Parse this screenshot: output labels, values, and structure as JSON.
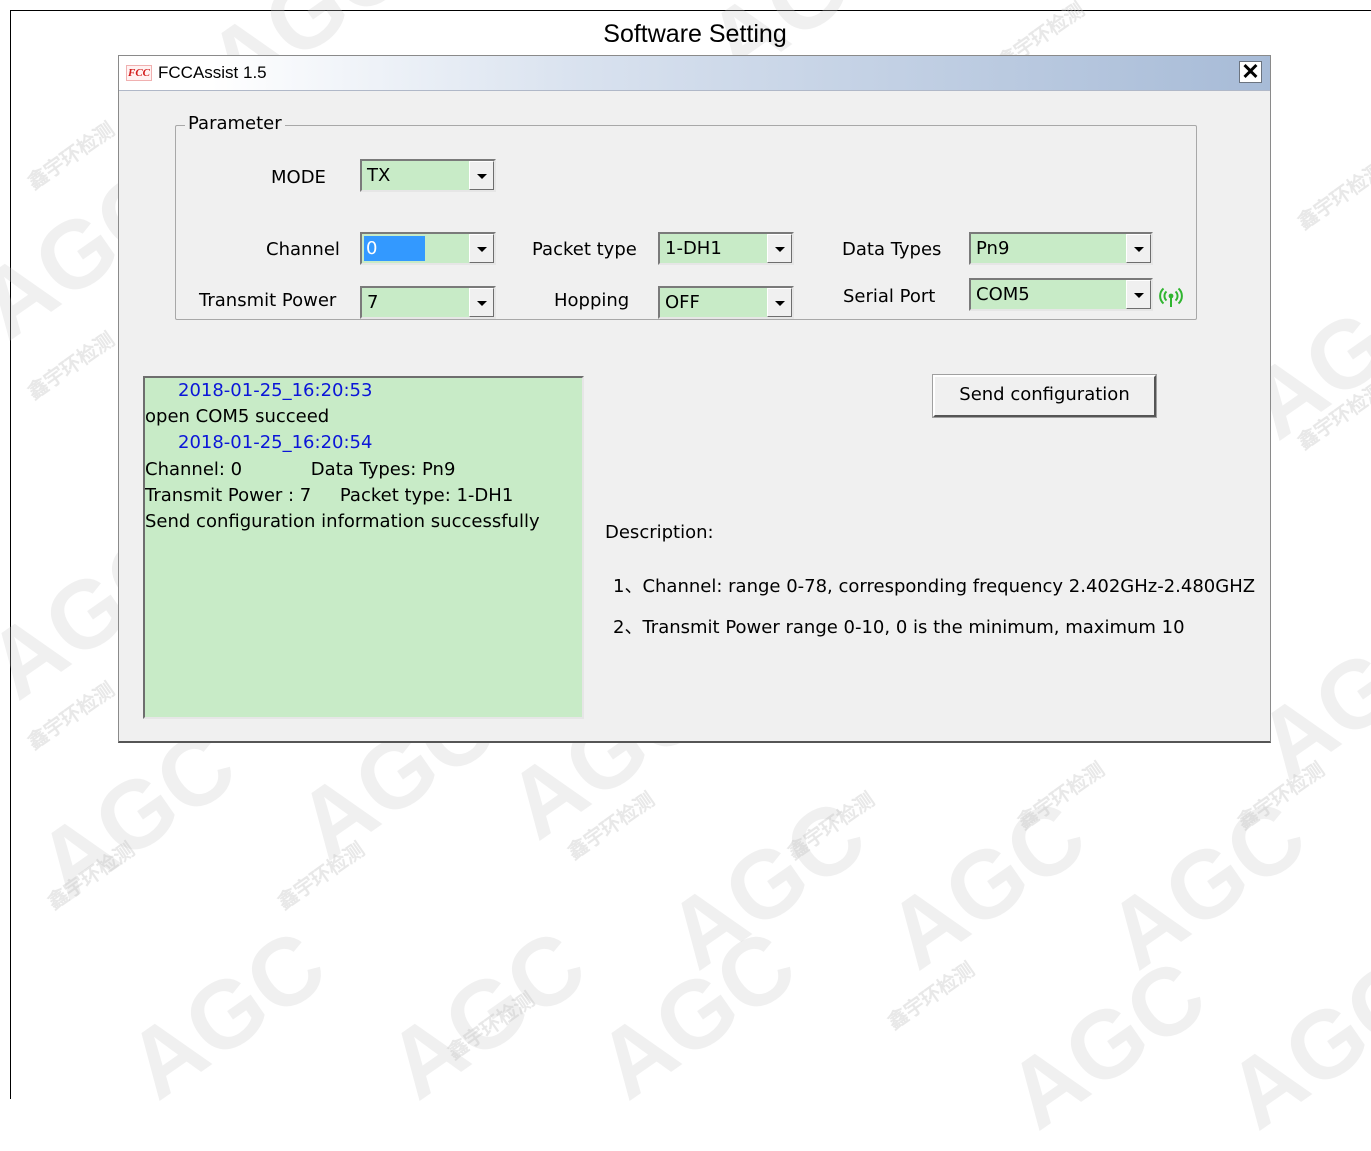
{
  "page": {
    "title": "Software Setting"
  },
  "window": {
    "icon_label": "FCC",
    "title": "FCCAssist 1.5",
    "close_label": "✕"
  },
  "parameter": {
    "group_label": "Parameter",
    "mode": {
      "label": "MODE",
      "value": "TX"
    },
    "channel": {
      "label": "Channel",
      "value": "0"
    },
    "packet_type": {
      "label": "Packet type",
      "value": "1-DH1"
    },
    "data_types": {
      "label": "Data Types",
      "value": "Pn9"
    },
    "transmit_power": {
      "label": "Transmit Power",
      "value": "7"
    },
    "hopping": {
      "label": "Hopping",
      "value": "OFF"
    },
    "serial_port": {
      "label": "Serial Port",
      "value": "COM5",
      "status_icon": "wireless-signal-icon",
      "status_color": "#2fb52f"
    }
  },
  "log": {
    "lines": [
      {
        "type": "timestamp",
        "text": "2018-01-25_16:20:53"
      },
      {
        "type": "message",
        "text": "open COM5 succeed"
      },
      {
        "type": "timestamp",
        "text": "2018-01-25_16:20:54"
      },
      {
        "type": "message",
        "text": "Channel: 0            Data Types: Pn9"
      },
      {
        "type": "message",
        "text": "Transmit Power : 7     Packet type: 1-DH1"
      },
      {
        "type": "message",
        "text": "Send configuration information successfully"
      }
    ]
  },
  "actions": {
    "send_configuration_label": "Send configuration"
  },
  "description": {
    "title": "Description:",
    "items": [
      "1、Channel: range 0-78, corresponding frequency 2.402GHz-2.480GHZ",
      "2、Transmit Power  range 0-10, 0 is the minimum, maximum 10"
    ]
  },
  "watermark": {
    "brand": "AGC",
    "tagline": "鑫宇环检测"
  },
  "colors": {
    "field_background": "#c8ebc7",
    "timestamp_text": "#0b16d8",
    "selection": "#3399ff"
  }
}
